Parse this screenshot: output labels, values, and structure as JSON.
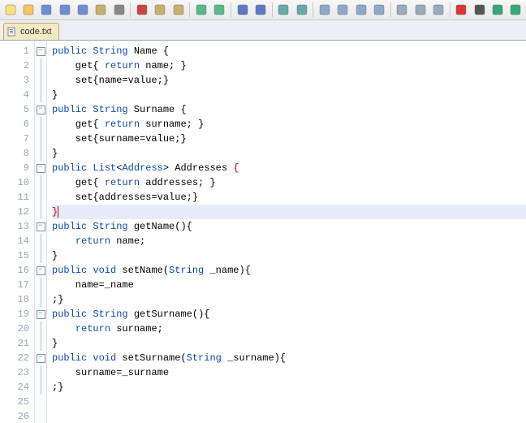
{
  "toolbar": {
    "icons": [
      "new-file-icon",
      "open-icon",
      "save-icon",
      "save-all-icon",
      "save-as-icon",
      "copy-file-icon",
      "print-icon",
      "sep",
      "cut-icon",
      "copy-icon",
      "paste-icon",
      "sep",
      "undo-icon",
      "redo-icon",
      "sep",
      "find-icon",
      "replace-icon",
      "sep",
      "zoom-in-icon",
      "zoom-out-icon",
      "sep",
      "window-split-h-icon",
      "window-split-v-icon",
      "window-layout-icon",
      "window-cascade-icon",
      "sep",
      "toggle-panel-icon",
      "line-numbers-icon",
      "word-wrap-icon",
      "sep",
      "record-macro-icon",
      "stop-macro-icon",
      "play-macro-icon",
      "play-all-icon"
    ]
  },
  "tabs": [
    {
      "label": "code.txt",
      "active": true
    }
  ],
  "editor": {
    "current_line": 12,
    "lines": [
      {
        "n": 1,
        "fold": "box",
        "tokens": [
          [
            "kw",
            "public"
          ],
          [
            " "
          ],
          [
            "kw",
            "String"
          ],
          [
            " Name "
          ],
          [
            "brace",
            "{"
          ]
        ]
      },
      {
        "n": 2,
        "fold": "rule",
        "tokens": [
          [
            "    get"
          ],
          [
            "brace",
            "{"
          ],
          [
            " "
          ],
          [
            "kw",
            "return"
          ],
          [
            " name; "
          ],
          [
            "brace",
            "}"
          ]
        ]
      },
      {
        "n": 3,
        "fold": "rule",
        "tokens": [
          [
            "    set"
          ],
          [
            "brace",
            "{"
          ],
          [
            "name=value;"
          ],
          [
            "brace",
            "}"
          ]
        ]
      },
      {
        "n": 4,
        "fold": "rule",
        "tokens": [
          [
            "brace",
            "}"
          ]
        ]
      },
      {
        "n": 5,
        "fold": "box",
        "tokens": [
          [
            "kw",
            "public"
          ],
          [
            " "
          ],
          [
            "kw",
            "String"
          ],
          [
            " Surname "
          ],
          [
            "brace",
            "{"
          ]
        ]
      },
      {
        "n": 6,
        "fold": "rule",
        "tokens": [
          [
            "    get"
          ],
          [
            "brace",
            "{"
          ],
          [
            " "
          ],
          [
            "kw",
            "return"
          ],
          [
            " surname; "
          ],
          [
            "brace",
            "}"
          ]
        ]
      },
      {
        "n": 7,
        "fold": "rule",
        "tokens": [
          [
            "    set"
          ],
          [
            "brace",
            "{"
          ],
          [
            "surname=value;"
          ],
          [
            "brace",
            "}"
          ]
        ]
      },
      {
        "n": 8,
        "fold": "rule",
        "tokens": [
          [
            "brace",
            "}"
          ]
        ]
      },
      {
        "n": 9,
        "fold": "box",
        "tokens": [
          [
            "kw",
            "public"
          ],
          [
            " "
          ],
          [
            "kw",
            "List"
          ],
          [
            "<"
          ],
          [
            "kw",
            "Address"
          ],
          [
            "> Addresses "
          ],
          [
            "redbrace",
            "{"
          ]
        ]
      },
      {
        "n": 10,
        "fold": "rule",
        "tokens": [
          [
            "    get"
          ],
          [
            "brace",
            "{"
          ],
          [
            " "
          ],
          [
            "kw",
            "return"
          ],
          [
            " addresses; "
          ],
          [
            "brace",
            "}"
          ]
        ]
      },
      {
        "n": 11,
        "fold": "rule",
        "tokens": [
          [
            "    set"
          ],
          [
            "brace",
            "{"
          ],
          [
            "addresses=value;"
          ],
          [
            "brace",
            "}"
          ]
        ]
      },
      {
        "n": 12,
        "fold": "rule",
        "tokens": [
          [
            "redbrace",
            "}"
          ]
        ],
        "highlight": true,
        "cursor": true
      },
      {
        "n": 13,
        "fold": "box",
        "tokens": [
          [
            "kw",
            "public"
          ],
          [
            " "
          ],
          [
            "kw",
            "String"
          ],
          [
            " getName"
          ],
          [
            "brace",
            "("
          ],
          [
            "brace",
            ")"
          ],
          [
            "brace",
            "{"
          ]
        ]
      },
      {
        "n": 14,
        "fold": "rule",
        "tokens": [
          [
            "    "
          ],
          [
            "kw",
            "return"
          ],
          [
            " name;"
          ]
        ]
      },
      {
        "n": 15,
        "fold": "rule",
        "tokens": [
          [
            "brace",
            "}"
          ]
        ]
      },
      {
        "n": 16,
        "fold": "box",
        "tokens": [
          [
            "kw",
            "public"
          ],
          [
            " "
          ],
          [
            "kw",
            "void"
          ],
          [
            " setName"
          ],
          [
            "brace",
            "("
          ],
          [
            "kw",
            "String"
          ],
          [
            " _name"
          ],
          [
            "brace",
            ")"
          ],
          [
            "brace",
            "{"
          ]
        ]
      },
      {
        "n": 17,
        "fold": "rule",
        "tokens": [
          [
            "    name=_name"
          ]
        ]
      },
      {
        "n": 18,
        "fold": "rule",
        "tokens": [
          [
            ";"
          ],
          [
            "brace",
            "}"
          ]
        ]
      },
      {
        "n": 19,
        "fold": "box",
        "tokens": [
          [
            "kw",
            "public"
          ],
          [
            " "
          ],
          [
            "kw",
            "String"
          ],
          [
            " getSurname"
          ],
          [
            "brace",
            "("
          ],
          [
            "brace",
            ")"
          ],
          [
            "brace",
            "{"
          ]
        ]
      },
      {
        "n": 20,
        "fold": "rule",
        "tokens": [
          [
            "    "
          ],
          [
            "kw",
            "return"
          ],
          [
            " surname;"
          ]
        ]
      },
      {
        "n": 21,
        "fold": "rule",
        "tokens": [
          [
            "brace",
            "}"
          ]
        ]
      },
      {
        "n": 22,
        "fold": "box",
        "tokens": [
          [
            "kw",
            "public"
          ],
          [
            " "
          ],
          [
            "kw",
            "void"
          ],
          [
            " setSurname"
          ],
          [
            "brace",
            "("
          ],
          [
            "kw",
            "String"
          ],
          [
            " _surname"
          ],
          [
            "brace",
            ")"
          ],
          [
            "brace",
            "{"
          ]
        ]
      },
      {
        "n": 23,
        "fold": "rule",
        "tokens": [
          [
            "    surname=_surname"
          ]
        ]
      },
      {
        "n": 24,
        "fold": "rule",
        "tokens": [
          [
            ";"
          ],
          [
            "brace",
            "}"
          ]
        ]
      },
      {
        "n": 25,
        "fold": "none",
        "tokens": []
      },
      {
        "n": 26,
        "fold": "none",
        "tokens": []
      }
    ]
  }
}
